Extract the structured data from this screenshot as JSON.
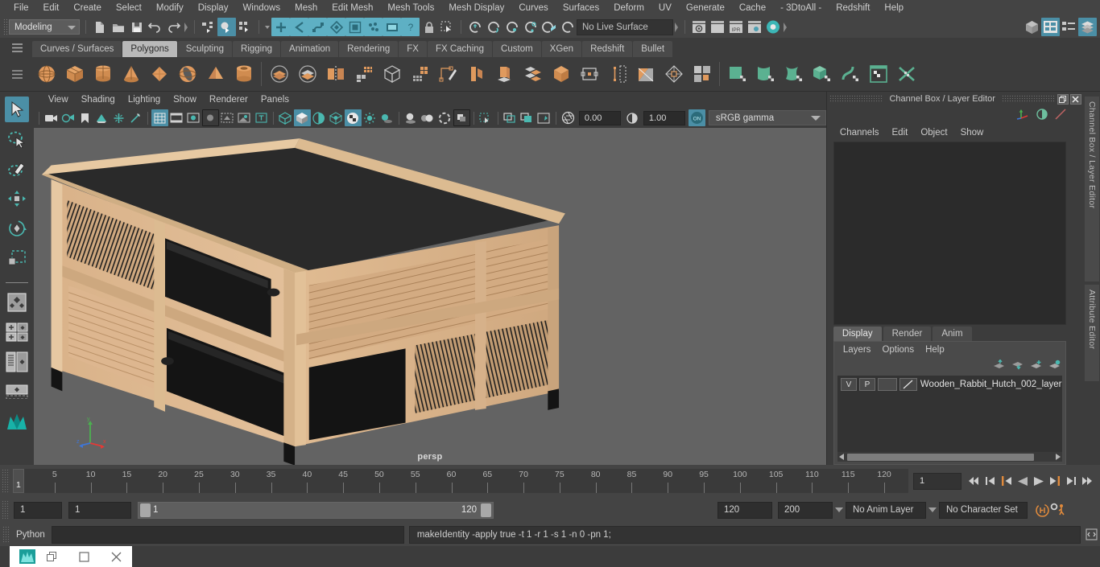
{
  "menubar": {
    "items": [
      "File",
      "Edit",
      "Create",
      "Select",
      "Modify",
      "Display",
      "Windows",
      "Mesh",
      "Edit Mesh",
      "Mesh Tools",
      "Mesh Display",
      "Curves",
      "Surfaces",
      "Deform",
      "UV",
      "Generate",
      "Cache",
      "- 3DtoAll -",
      "Redshift",
      "Help"
    ]
  },
  "statusline": {
    "menu_set": "Modeling",
    "live_surface": "No Live Surface"
  },
  "shelf": {
    "tabs": [
      "Curves / Surfaces",
      "Polygons",
      "Sculpting",
      "Rigging",
      "Animation",
      "Rendering",
      "FX",
      "FX Caching",
      "Custom",
      "XGen",
      "Redshift",
      "Bullet"
    ],
    "active_tab": "Polygons"
  },
  "viewport": {
    "menu": [
      "View",
      "Shading",
      "Lighting",
      "Show",
      "Renderer",
      "Panels"
    ],
    "exposure": "0.00",
    "gamma": "1.00",
    "color_mgmt": "sRGB gamma",
    "camera_label": "persp",
    "axis_labels": {
      "x": "x",
      "y": "y",
      "z": "z"
    }
  },
  "channel_box": {
    "title": "Channel Box / Layer Editor",
    "menu": [
      "Channels",
      "Edit",
      "Object",
      "Show"
    ]
  },
  "layer_editor": {
    "tabs": [
      "Display",
      "Render",
      "Anim"
    ],
    "active_tab": "Display",
    "menu": [
      "Layers",
      "Options",
      "Help"
    ],
    "rows": [
      {
        "visibility": "V",
        "playback": "P",
        "shading": "",
        "name": "Wooden_Rabbit_Hutch_002_layer"
      }
    ]
  },
  "vertical_tabs": [
    "Channel Box / Layer Editor",
    "Attribute Editor"
  ],
  "time_slider": {
    "ticks": [
      5,
      10,
      15,
      20,
      25,
      30,
      35,
      40,
      45,
      50,
      55,
      60,
      65,
      70,
      75,
      80,
      85,
      90,
      95,
      100,
      105,
      110,
      115,
      120
    ],
    "current_marker": "1",
    "current_frame_field": "1"
  },
  "range_slider": {
    "anim_start": "1",
    "range_start": "1",
    "bar_start_label": "1",
    "bar_end_label": "120",
    "range_end": "120",
    "anim_end": "200",
    "anim_layer": "No Anim Layer",
    "character_set": "No Character Set"
  },
  "command_line": {
    "language": "Python",
    "input_value": "",
    "output": "makeIdentity -apply true -t 1 -r 1 -s 1 -n 0 -pn 1;"
  },
  "taskbar": {
    "app_icon": "maya-app-icon",
    "restore_label": "restore-icon",
    "close_label": "close-icon"
  },
  "colors": {
    "accent_blue": "#4b8fa6",
    "accent_teal": "#4ab8b0",
    "shelf_orange": "#e09a5e",
    "shelf_green": "#5bb191",
    "panel_bg": "#3c3c3c",
    "chrome_bg": "#444444",
    "viewport_bg": "#636363"
  }
}
